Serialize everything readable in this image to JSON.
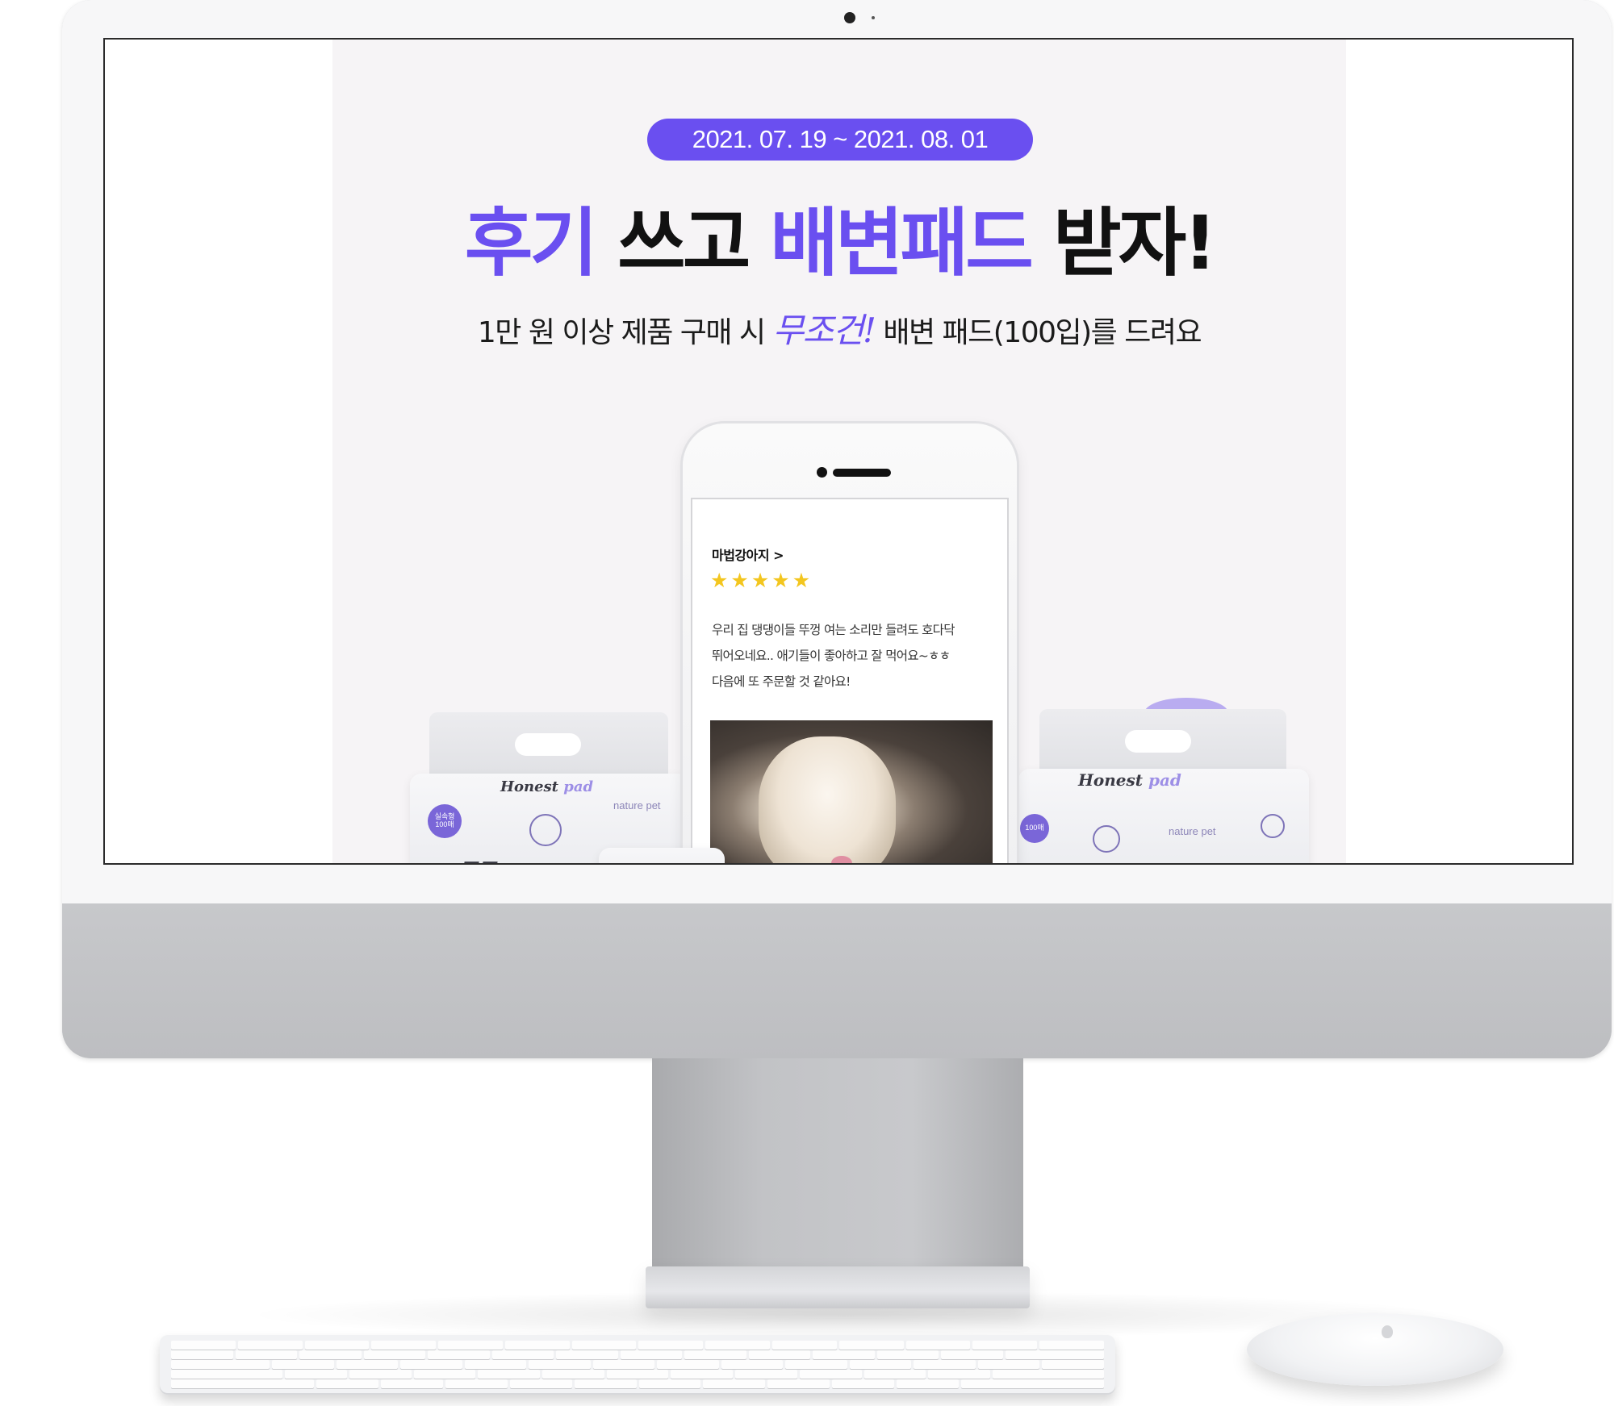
{
  "event": {
    "date_range": "2021. 07. 19 ~ 2021. 08. 01",
    "headline": {
      "part1": "후기",
      "part2": " 쓰고 ",
      "part3": "배변패드",
      "part4": " 받자!"
    },
    "subline": {
      "before": "1만 원 이상 제품 구매 시 ",
      "emphasis": "무조건!",
      "after": " 배변 패드(100입)를 드려요"
    }
  },
  "review": {
    "reviewer": "마법강아지 >",
    "rating": 5,
    "text_lines": [
      "우리 집 댕댕이들 뚜껑 여는 소리만 들려도 호다닥",
      "뛰어오네요.. 애기들이 좋아하고 잘 먹어요~ㅎㅎ",
      "다음에 또 주문할 것 같아요!"
    ]
  },
  "products": {
    "left": {
      "brand": "Honest",
      "brand_sub": "pad",
      "maker": "nature pet",
      "badge": "실속형 100매",
      "big": "Honest pa"
    },
    "right": {
      "brand": "Honest",
      "brand_sub": "pad",
      "maker": "nature pet",
      "badge": "100매"
    }
  },
  "colors": {
    "accent": "#6a4ff0",
    "star": "#f3c61f",
    "background": "#f6f4f6"
  },
  "icons": {
    "star": "star-icon",
    "camera": "camera-icon",
    "apple": "apple-logo-icon"
  }
}
